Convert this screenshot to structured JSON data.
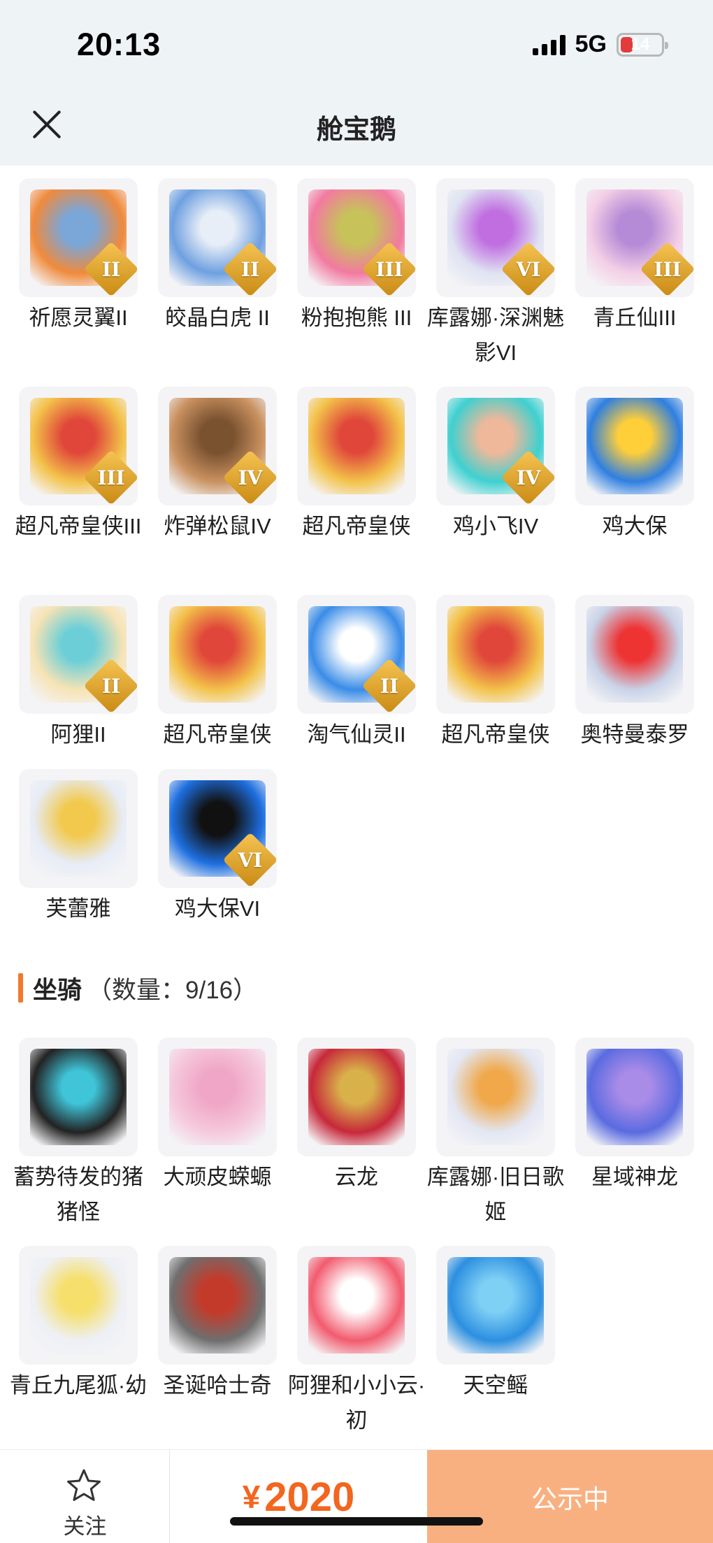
{
  "status_bar": {
    "time": "20:13",
    "network": "5G",
    "battery": "14"
  },
  "header": {
    "title": "舱宝鹅"
  },
  "pets": [
    {
      "name": "祈愿灵翼II",
      "rank": "II",
      "icon": "griffin-icon",
      "colors": [
        "#f08a3c",
        "#7aa6d8"
      ]
    },
    {
      "name": "皎晶白虎 II",
      "rank": "II",
      "icon": "tiger-icon",
      "colors": [
        "#6ea0e0",
        "#e8eef7"
      ]
    },
    {
      "name": "粉抱抱熊 III",
      "rank": "III",
      "icon": "bear-icon",
      "colors": [
        "#f27aa0",
        "#c7c25a"
      ]
    },
    {
      "name": "库露娜·深渊魅影VI",
      "rank": "VI",
      "icon": "fairy-icon",
      "colors": [
        "#dfe3f2",
        "#c06ee0"
      ]
    },
    {
      "name": "青丘仙III",
      "rank": "III",
      "icon": "fox-girl-icon",
      "colors": [
        "#f3cfe6",
        "#b58ad6"
      ]
    },
    {
      "name": "超凡帝皇侠III",
      "rank": "III",
      "icon": "knight-icon",
      "colors": [
        "#f3c24a",
        "#e0473a"
      ]
    },
    {
      "name": "炸弹松鼠IV",
      "rank": "IV",
      "icon": "squirrel-icon",
      "colors": [
        "#c99160",
        "#7a5230"
      ]
    },
    {
      "name": "超凡帝皇侠",
      "rank": "",
      "icon": "knight-icon",
      "colors": [
        "#f3c24a",
        "#e0473a"
      ]
    },
    {
      "name": "鸡小飞IV",
      "rank": "IV",
      "icon": "chick-icon",
      "colors": [
        "#3fd0d0",
        "#f0b89a"
      ]
    },
    {
      "name": "鸡大保",
      "rank": "",
      "icon": "bird-icon",
      "colors": [
        "#2f7fe0",
        "#ffcf3a"
      ]
    },
    {
      "name": "阿狸II",
      "rank": "II",
      "icon": "fox-icon",
      "colors": [
        "#f7e3b5",
        "#6ccfd8"
      ]
    },
    {
      "name": "超凡帝皇侠",
      "rank": "",
      "icon": "knight-icon",
      "colors": [
        "#f3c24a",
        "#e0473a"
      ]
    },
    {
      "name": "淘气仙灵II",
      "rank": "II",
      "icon": "puppy-icon",
      "colors": [
        "#3a8ce8",
        "#ffffff"
      ]
    },
    {
      "name": "超凡帝皇侠",
      "rank": "",
      "icon": "knight-icon",
      "colors": [
        "#f3c24a",
        "#e0473a"
      ]
    },
    {
      "name": "奥特曼泰罗",
      "rank": "",
      "icon": "ultraman-icon",
      "colors": [
        "#c9d3e8",
        "#e33"
      ]
    },
    {
      "name": "芙蕾雅",
      "rank": "",
      "icon": "goddess-icon",
      "colors": [
        "#e7ecf6",
        "#f2c94c"
      ]
    },
    {
      "name": "鸡大保VI",
      "rank": "VI",
      "icon": "bird-icon",
      "colors": [
        "#1e6fe0",
        "#111"
      ]
    }
  ],
  "mounts_section": {
    "title": "坐骑",
    "count": "（数量：9/16）"
  },
  "mounts": [
    {
      "name": "蓄势待发的猪猪怪",
      "icon": "pig-icon",
      "colors": [
        "#222",
        "#3fc4d8"
      ]
    },
    {
      "name": "大顽皮蝾螈",
      "icon": "salamander-icon",
      "colors": [
        "#f5c9dc",
        "#f0a6c6"
      ]
    },
    {
      "name": "云龙",
      "icon": "dragon-icon",
      "colors": [
        "#c7283a",
        "#d9b14a"
      ]
    },
    {
      "name": "库露娜·旧日歌姬",
      "icon": "fairy-icon",
      "colors": [
        "#e3e7f4",
        "#f0a84a"
      ]
    },
    {
      "name": "星域神龙",
      "icon": "space-dragon-icon",
      "colors": [
        "#5a6be0",
        "#a98be8"
      ]
    },
    {
      "name": "青丘九尾狐·幼",
      "icon": "nine-tail-fox-icon",
      "colors": [
        "#eef0f6",
        "#f6df6a"
      ]
    },
    {
      "name": "圣诞哈士奇",
      "icon": "husky-icon",
      "colors": [
        "#6f6f6f",
        "#c43a2a"
      ]
    },
    {
      "name": "阿狸和小小云·初",
      "icon": "cloud-fox-icon",
      "colors": [
        "#f25b6e",
        "#ffffff"
      ]
    },
    {
      "name": "天空鳐",
      "icon": "manta-icon",
      "colors": [
        "#2c8fe0",
        "#7fd0f5"
      ]
    }
  ],
  "bottom_bar": {
    "follow_label": "关注",
    "price_symbol": "¥",
    "price": "2020",
    "status_label": "公示中"
  }
}
